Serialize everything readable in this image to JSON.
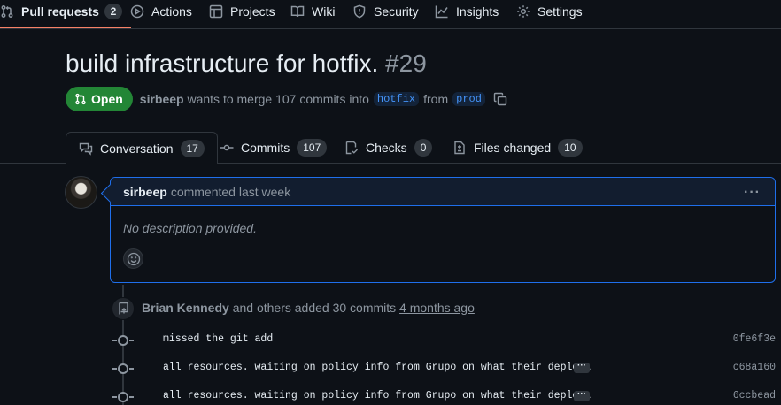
{
  "repo_nav": {
    "items": [
      {
        "label": "Pull requests",
        "icon": "git-pull-request-icon",
        "count": "2",
        "active": true
      },
      {
        "label": "Actions",
        "icon": "play-icon"
      },
      {
        "label": "Projects",
        "icon": "table-icon"
      },
      {
        "label": "Wiki",
        "icon": "book-icon"
      },
      {
        "label": "Security",
        "icon": "shield-icon"
      },
      {
        "label": "Insights",
        "icon": "graph-icon"
      },
      {
        "label": "Settings",
        "icon": "gear-icon"
      }
    ]
  },
  "pr": {
    "title": "build infrastructure for hotfix.",
    "number": "#29",
    "state": "Open",
    "author": "sirbeep",
    "merge_text": "wants to merge 107 commits into",
    "base_branch": "hotfix",
    "from_text": "from",
    "head_branch": "prod"
  },
  "tabs": [
    {
      "label": "Conversation",
      "count": "17",
      "icon": "comment-discussion-icon",
      "selected": true
    },
    {
      "label": "Commits",
      "count": "107",
      "icon": "git-commit-icon"
    },
    {
      "label": "Checks",
      "count": "0",
      "icon": "checklist-icon"
    },
    {
      "label": "Files changed",
      "count": "10",
      "icon": "file-diff-icon"
    }
  ],
  "comment": {
    "author": "sirbeep",
    "action": "commented last week",
    "body": "No description provided.",
    "menu": "···"
  },
  "timeline": {
    "push_author": "Brian Kennedy",
    "push_text": "and others added 30 commits",
    "push_time": "4 months ago",
    "commits": [
      {
        "message": "missed the git add",
        "sha": "0fe6f3e",
        "truncated": false
      },
      {
        "message": "all resources. waiting on policy info from Grupo on what their deploy…",
        "sha": "c68a160",
        "truncated": true
      },
      {
        "message": "all resources. waiting on policy info from Grupo on what their deploy…",
        "sha": "6ccbead",
        "truncated": true
      }
    ],
    "more_label": "···"
  },
  "colors": {
    "background": "#0d1117",
    "open_green": "#238636",
    "accent_blue": "#1f6feb",
    "active_underline": "#f78166"
  }
}
